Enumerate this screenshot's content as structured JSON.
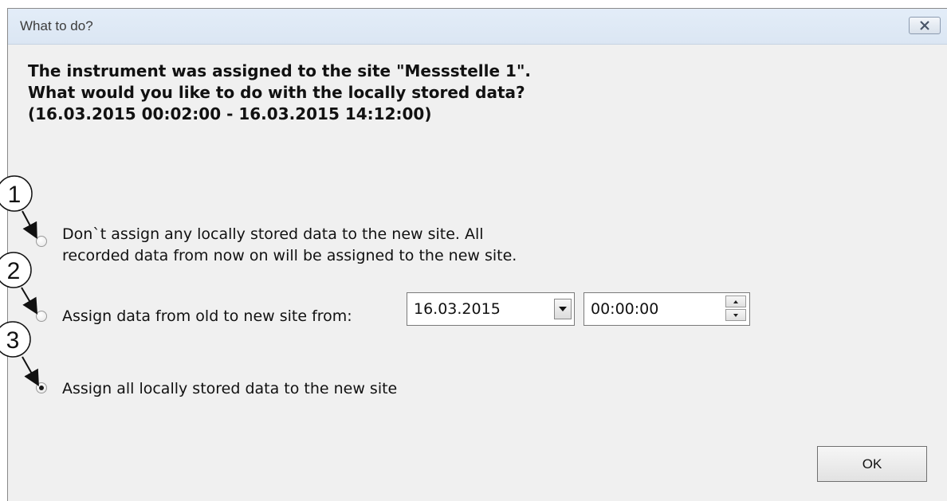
{
  "window": {
    "title": "What to do?"
  },
  "message": {
    "line1": "The instrument was assigned to the site \"Messstelle 1\".",
    "line2": "What would you like to do with the locally stored data?",
    "line3": "(16.03.2015 00:02:00 - 16.03.2015 14:12:00)"
  },
  "options": [
    {
      "line1": "Don`t assign any locally stored data to the new site. All",
      "line2": "recorded data from now on will be assigned to the new site.",
      "selected": false
    },
    {
      "label": "Assign data from old to new site from:",
      "selected": false
    },
    {
      "label": "Assign all locally stored data to the new site",
      "selected": true
    }
  ],
  "date_field": {
    "value": "16.03.2015"
  },
  "time_field": {
    "value": "00:00:00"
  },
  "ok_button": {
    "label": "OK"
  },
  "callouts": [
    "1",
    "2",
    "3"
  ]
}
